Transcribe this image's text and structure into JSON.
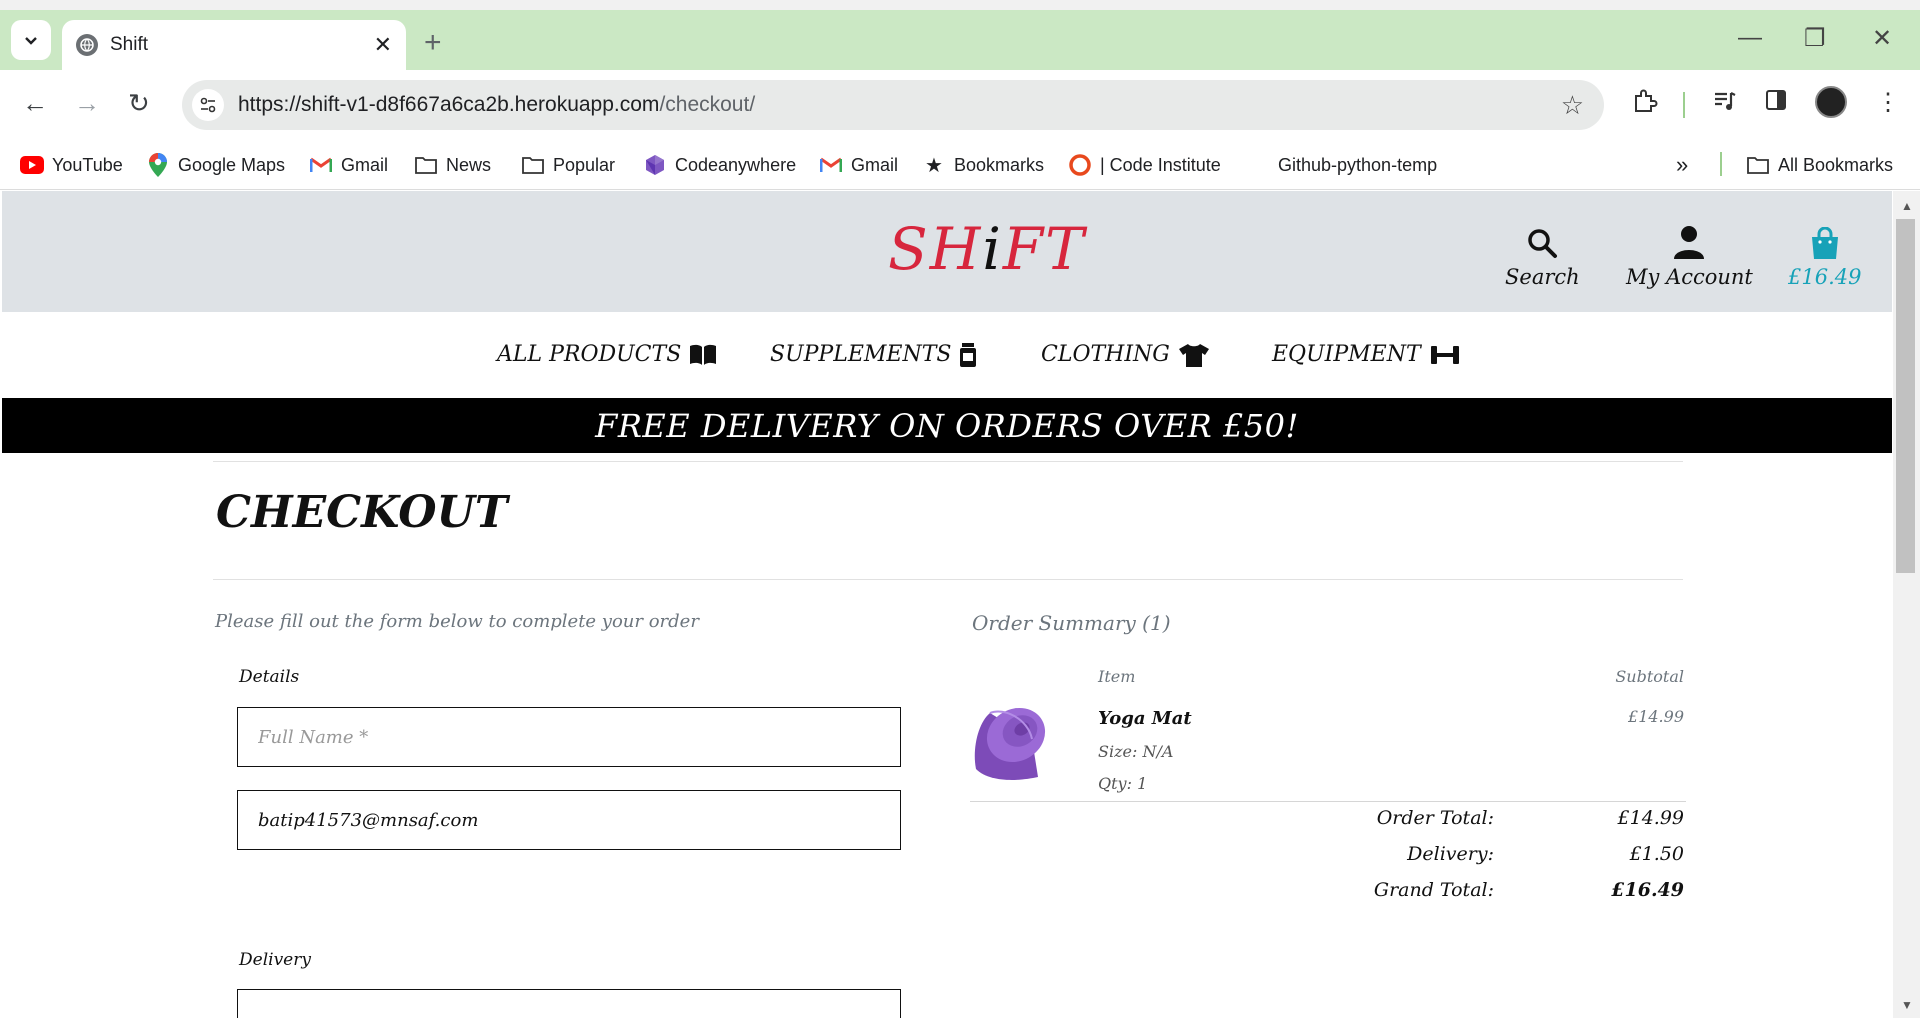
{
  "browser": {
    "tab_title": "Shift",
    "url_host": "https://shift-v1-d8f667a6ca2b.herokuapp.com",
    "url_path": "/checkout/",
    "bookmarks": [
      {
        "label": "YouTube",
        "icon": "youtube-icon"
      },
      {
        "label": "Google Maps",
        "icon": "maps-pin-icon"
      },
      {
        "label": "Gmail",
        "icon": "gmail-icon"
      },
      {
        "label": "News",
        "icon": "folder-icon"
      },
      {
        "label": "Popular",
        "icon": "folder-icon"
      },
      {
        "label": "Codeanywhere",
        "icon": "codeanywhere-icon"
      },
      {
        "label": "Gmail",
        "icon": "gmail-icon"
      },
      {
        "label": "Bookmarks",
        "icon": "star-icon"
      },
      {
        "label": "| Code Institute",
        "icon": "code-institute-icon"
      },
      {
        "label": "Github-python-temp",
        "icon": ""
      }
    ],
    "all_bookmarks": "All Bookmarks"
  },
  "site": {
    "logo": {
      "a": "SH",
      "b": "i",
      "c": "FT"
    },
    "header": {
      "search": "Search",
      "account": "My Account",
      "cart_total": "£16.49"
    },
    "nav": [
      {
        "label": "ALL PRODUCTS",
        "icon": "book-icon"
      },
      {
        "label": "SUPPLEMENTS",
        "icon": "tub-icon"
      },
      {
        "label": "CLOTHING",
        "icon": "shirt-icon"
      },
      {
        "label": "EQUIPMENT",
        "icon": "dumbbell-icon"
      }
    ],
    "banner": "FREE DELIVERY ON ORDERS OVER £50!"
  },
  "checkout": {
    "title": "CHECKOUT",
    "intro": "Please fill out the form below to complete your order",
    "details_legend": "Details",
    "full_name_placeholder": "Full Name *",
    "email_value": "batip41573@mnsaf.com",
    "delivery_legend": "Delivery"
  },
  "summary": {
    "heading": "Order Summary (1)",
    "col_item": "Item",
    "col_subtotal": "Subtotal",
    "item": {
      "name": "Yoga Mat",
      "size": "Size: N/A",
      "qty": "Qty: 1",
      "subtotal": "£14.99",
      "image_color": "#8e5ac8"
    },
    "order_total_label": "Order Total:",
    "order_total": "£14.99",
    "delivery_label": "Delivery:",
    "delivery": "£1.50",
    "grand_total_label": "Grand Total:",
    "grand_total": "£16.49"
  },
  "colors": {
    "logo_red": "#d7263d",
    "cart_teal": "#17a2b8",
    "header_bg": "#dee2e6",
    "tabbar_bg": "#cbe8c4"
  }
}
